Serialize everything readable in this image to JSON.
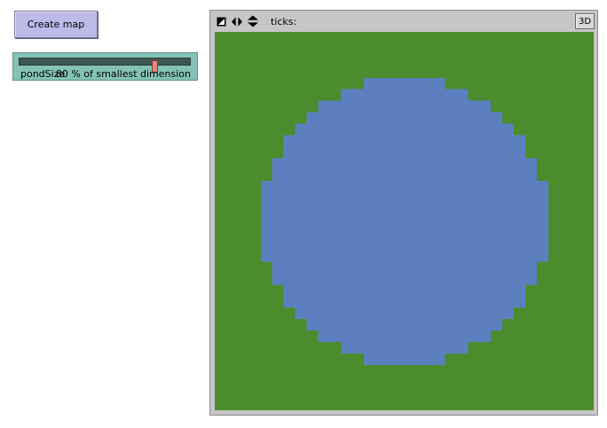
{
  "create_button": {
    "label": "Create map"
  },
  "slider": {
    "name": "pondSize",
    "value": 80,
    "units": "% of smallest dimension",
    "value_text": "80 % of smallest dimension",
    "fill_fraction": 0.8
  },
  "view": {
    "ticks_label": "ticks:",
    "ticks_value": "",
    "three_d_label": "3D",
    "icons": [
      "edit-icon",
      "horizontal-arrows-icon",
      "vertical-arrows-icon"
    ]
  },
  "world": {
    "grid_size": 33,
    "pond_radius": 12.5,
    "land_color": "#4b8c2d",
    "water_color": "#5d7fbf"
  },
  "colors": {
    "button_bg": "#bdb9e8",
    "slider_bg": "#85c2b6",
    "view_frame": "#c6c6c6"
  }
}
